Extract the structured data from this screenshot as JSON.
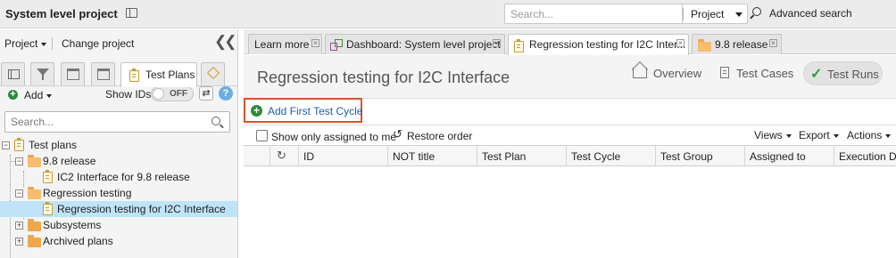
{
  "topbar": {
    "project_title": "System level project",
    "search_placeholder": "Search...",
    "search_scope": "Project",
    "advanced_search": "Advanced search"
  },
  "left_panel": {
    "project_menu": "Project",
    "change_project": "Change project",
    "collapse_icon": "double-chevron-left",
    "tabs": [
      {
        "icon": "list-icon"
      },
      {
        "icon": "filter-icon"
      },
      {
        "icon": "calendar-icon"
      },
      {
        "icon": "window-icon"
      },
      {
        "icon": "test-plan-icon",
        "label": "Test Plans"
      },
      {
        "icon": "tag-icon"
      }
    ],
    "add_label": "Add",
    "show_ids_label": "Show IDs",
    "show_ids_toggle": "OFF",
    "search_placeholder": "Search...",
    "tree": [
      {
        "label": "Test plans",
        "level": 0,
        "icon": "test-plan-icon",
        "expander": "−"
      },
      {
        "label": "9.8 release",
        "level": 1,
        "icon": "folder-open-icon",
        "expander": "−"
      },
      {
        "label": "IC2 Interface for 9.8 release",
        "level": 2,
        "icon": "test-plan-icon"
      },
      {
        "label": "Regression testing",
        "level": 1,
        "icon": "folder-open-icon",
        "expander": "−"
      },
      {
        "label": "Regression testing for I2C Interface",
        "level": 2,
        "icon": "test-plan-icon",
        "selected": true
      },
      {
        "label": "Subsystems",
        "level": 1,
        "icon": "folder-icon",
        "expander": "+"
      },
      {
        "label": "Archived plans",
        "level": 1,
        "icon": "folder-icon",
        "expander": "+"
      }
    ]
  },
  "tabs": [
    {
      "label": "Learn more",
      "icon": ""
    },
    {
      "label": "Dashboard: System level project",
      "icon": "dashboard-icon"
    },
    {
      "label": "Regression testing for I2C Inter...",
      "icon": "test-plan-icon",
      "active": true
    },
    {
      "label": "9.8 release",
      "icon": "folder-icon"
    }
  ],
  "page": {
    "title": "Regression testing for I2C Interface",
    "views": {
      "overview": "Overview",
      "test_cases": "Test Cases",
      "test_runs": "Test Runs"
    },
    "add_first_cycle": "Add First Test Cycle",
    "show_only_assigned": "Show only assigned to me",
    "restore_order": "Restore order",
    "menus": {
      "views": "Views",
      "export": "Export",
      "actions": "Actions"
    },
    "columns": [
      "ID",
      "NOT title",
      "Test Plan",
      "Test Cycle",
      "Test Group",
      "Assigned to",
      "Execution Da"
    ]
  },
  "colors": {
    "accent_blue": "#1d5fa8",
    "selection": "#bfe4f7",
    "highlight_frame": "#d8542d",
    "add_green": "#2e8a3b",
    "folder": "#f0a74a"
  }
}
